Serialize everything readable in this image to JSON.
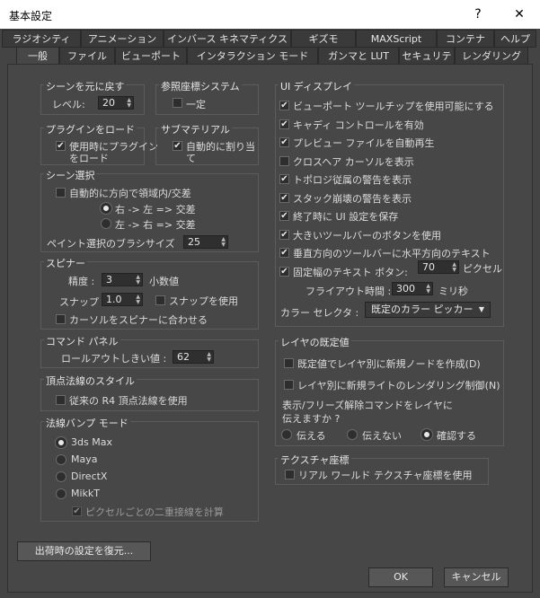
{
  "window": {
    "title": "基本設定",
    "help": "?",
    "close": "✕"
  },
  "tabs_row1": [
    "ラジオシティ",
    "アニメーション",
    "インバース キネマティクス",
    "ギズモ",
    "MAXScript",
    "コンテナ",
    "ヘルプ"
  ],
  "tabs_row2": [
    "一般",
    "ファイル",
    "ビューポート",
    "インタラクション モード",
    "ガンマと LUT",
    "セキュリティ",
    "レンダリング"
  ],
  "undo": {
    "title": "シーンを元に戻す",
    "level_label": "レベル:",
    "level_value": "20"
  },
  "ref_coord": {
    "title": "参照座標システム",
    "constant_label": "一定"
  },
  "plugin": {
    "title": "プラグインをロード",
    "load_label_1": "使用時にプラグイン",
    "load_label_2": "をロード"
  },
  "submaterial": {
    "title": "サブマテリアル",
    "auto_label_1": "自動的に割り当",
    "auto_label_2": "て"
  },
  "scene_select": {
    "title": "シーン選択",
    "auto_dir_label": "自動的に方向で領域内/交差",
    "rtl_label": "右 -> 左 => 交差",
    "ltr_label": "左 -> 右 => 交差",
    "brush_label": "ペイント選択のブラシサイズ",
    "brush_value": "25"
  },
  "spinner": {
    "title": "スピナー",
    "precision_label": "精度 :",
    "precision_value": "3",
    "decimal_label": "小数値",
    "snap_label": "スナップ :",
    "snap_value": "1.0",
    "use_snap_label": "スナップを使用",
    "wrap_cursor_label": "カーソルをスピナーに合わせる"
  },
  "command_panel": {
    "title": "コマンド パネル",
    "rollout_label": "ロールアウトしきい値 :",
    "rollout_value": "62"
  },
  "vertex_normal": {
    "title": "頂点法線のスタイル",
    "r4_label": "従来の R4 頂点法線を使用"
  },
  "normal_bump": {
    "title": "法線バンプ モード",
    "options": [
      "3ds Max",
      "Maya",
      "DirectX",
      "MikkT"
    ],
    "selected": "3ds Max",
    "per_pixel_label": "ピクセルごとの二重接線を計算"
  },
  "restore_button": "出荷時の設定を復元...",
  "ui_display": {
    "title": "UI ディスプレイ",
    "items": [
      "ビューポート ツールチップを使用可能にする",
      "キャディ コントロールを有効",
      "プレビュー ファイルを自動再生",
      "クロスヘア カーソルを表示",
      "トポロジ従属の警告を表示",
      "スタック崩壊の警告を表示",
      "終了時に UI 設定を保存",
      "大きいツールバーのボタンを使用",
      "垂直方向のツールバーに水平方向のテキスト",
      "固定幅のテキスト ボタン:"
    ],
    "checked": [
      true,
      true,
      true,
      false,
      true,
      true,
      true,
      true,
      true,
      true
    ],
    "fixed_width_value": "70",
    "pixel_unit": "ピクセル",
    "flyout_label": "フライアウト時間 :",
    "flyout_value": "300",
    "ms_unit": "ミリ秒",
    "color_selector_label": "カラー セレクタ :",
    "color_selector_value": "既定のカラー ピッカー"
  },
  "layer_defaults": {
    "title": "レイヤの既定値",
    "new_node_label": "既定値でレイヤ別に新規ノードを作成(D)",
    "new_light_label": "レイヤ別に新規ライトのレンダリング制御(N)",
    "prompt_line1": "表示/フリーズ解除コマンドをレイヤに",
    "prompt_line2": "伝えますか ?",
    "options": [
      "伝える",
      "伝えない",
      "確認する"
    ],
    "selected": "確認する"
  },
  "texture_coords": {
    "title": "テクスチャ座標",
    "real_world_label": "リアル ワールド テクスチャ座標を使用"
  },
  "footer": {
    "ok": "OK",
    "cancel": "キャンセル"
  }
}
